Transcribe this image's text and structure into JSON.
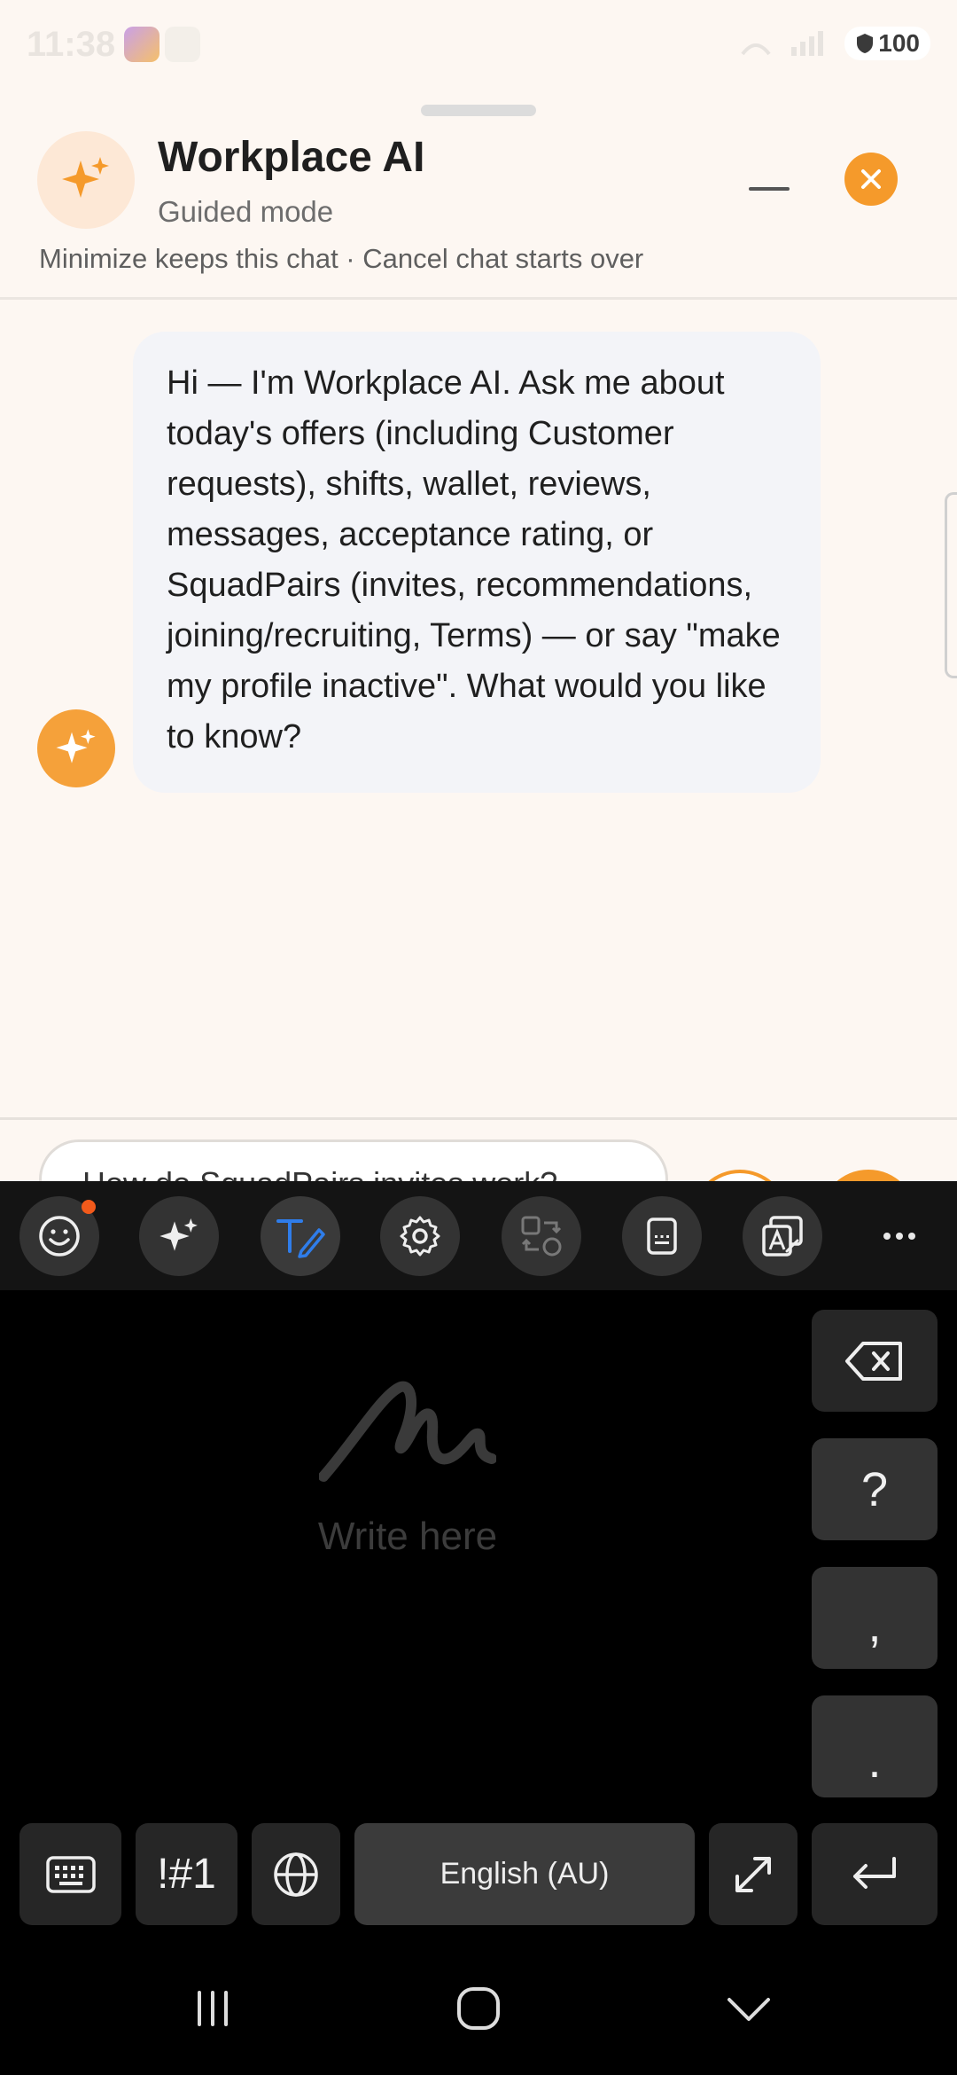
{
  "status_bar": {
    "time": "11:38",
    "battery": "100"
  },
  "header": {
    "title": "Workplace AI",
    "subtitle": "Guided mode",
    "hint": "Minimize keeps this chat · Cancel chat starts over"
  },
  "chat": {
    "messages": [
      {
        "sender": "bot",
        "text": "Hi — I'm Workplace AI. Ask me about today's offers (including Customer requests), shifts, wallet, reviews, messages, acceptance rating, or SquadPairs (invites, recommendations, joining/recruiting, Terms) — or say \"make my profile inactive\". What would you like to know?"
      }
    ]
  },
  "composer": {
    "input_value": "How do SquadPairs invites work?"
  },
  "keyboard": {
    "handwriting_placeholder": "Write here",
    "side_keys": {
      "question": "?",
      "comma": ",",
      "period": "."
    },
    "symbols_label": "!#1",
    "space_label": "English (AU)"
  },
  "colors": {
    "accent": "#f59a2b",
    "bubble": "#f3f4f8",
    "background": "#fdf7f2"
  }
}
